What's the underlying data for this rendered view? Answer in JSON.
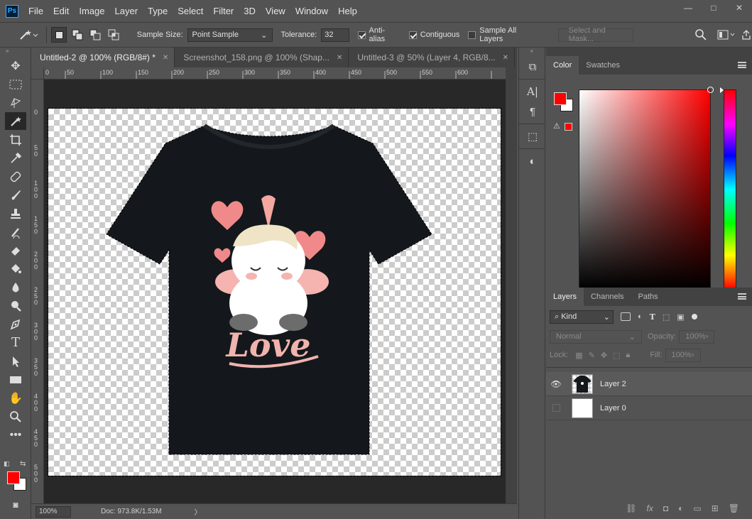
{
  "app": {
    "logo_text": "Ps"
  },
  "menu": [
    "File",
    "Edit",
    "Image",
    "Layer",
    "Type",
    "Select",
    "Filter",
    "3D",
    "View",
    "Window",
    "Help"
  ],
  "window_controls": {
    "min": "—",
    "max": "□",
    "close": "✕"
  },
  "options": {
    "sample_size_label": "Sample Size:",
    "sample_size_value": "Point Sample",
    "tolerance_label": "Tolerance:",
    "tolerance_value": "32",
    "antialias_label": "Anti-alias",
    "antialias_checked": true,
    "contiguous_label": "Contiguous",
    "contiguous_checked": true,
    "sample_all_label": "Sample All Layers",
    "sample_all_checked": false,
    "select_mask_label": "Select and Mask..."
  },
  "tabs": [
    {
      "label": "Untitled-2 @ 100% (RGB/8#) *",
      "active": true
    },
    {
      "label": "Screenshot_158.png @ 100% (Shap...",
      "active": false
    },
    {
      "label": "Untitled-3 @ 50% (Layer 4, RGB/8...",
      "active": false
    }
  ],
  "ruler_h": [
    "0",
    "50",
    "100",
    "150",
    "200",
    "250",
    "300",
    "350",
    "400",
    "450",
    "500",
    "550",
    "600"
  ],
  "ruler_v": [
    "0",
    "5 0",
    "1 0 0",
    "1 5 0",
    "2 0 0",
    "2 5 0",
    "3 0 0",
    "3 5 0",
    "4 0 0",
    "4 5 0",
    "5 0 0"
  ],
  "canvas": {
    "artwork_text": "Love"
  },
  "status": {
    "zoom": "100%",
    "doc": "Doc: 973.8K/1.53M",
    "arrow": "〉"
  },
  "colors": {
    "foreground": "#ff0000",
    "background": "#ffffff",
    "shirt": "#14181c"
  },
  "color_panel": {
    "tabs": [
      "Color",
      "Swatches"
    ],
    "active": "Color"
  },
  "layers_panel": {
    "tabs": [
      "Layers",
      "Channels",
      "Paths"
    ],
    "active": "Layers",
    "kind_label": "Kind",
    "blend_mode": "Normal",
    "opacity_label": "Opacity:",
    "opacity_value": "100%",
    "lock_label": "Lock:",
    "fill_label": "Fill:",
    "fill_value": "100%",
    "layers": [
      {
        "name": "Layer 2",
        "visible": true,
        "selected": true
      },
      {
        "name": "Layer 0",
        "visible": false,
        "selected": false
      }
    ]
  },
  "footer_icons": [
    "link-icon",
    "fx-icon",
    "mask-icon",
    "adjustment-icon",
    "group-icon",
    "new-layer-icon",
    "trash-icon"
  ]
}
